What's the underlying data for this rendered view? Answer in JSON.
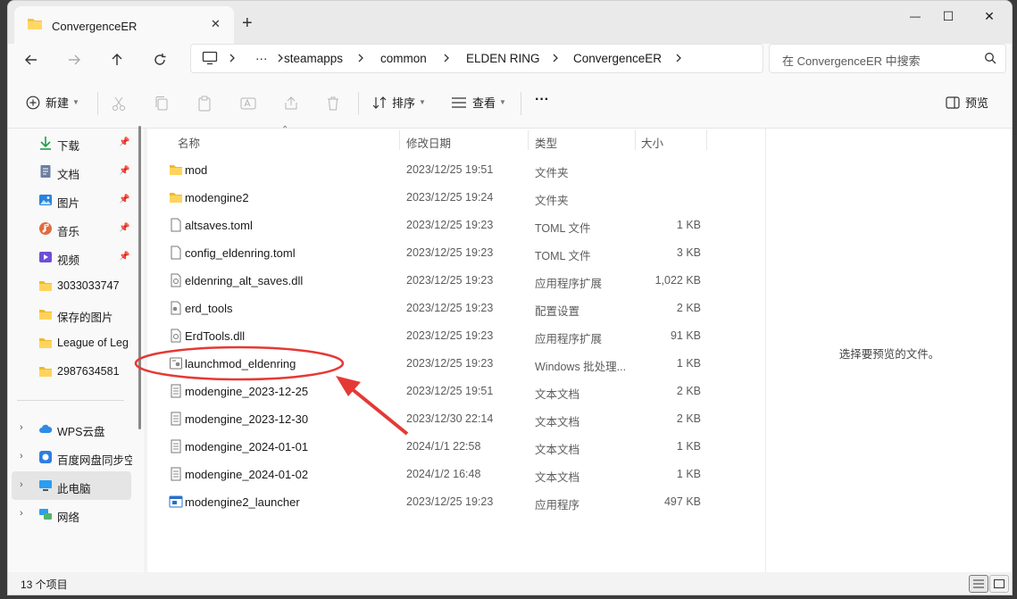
{
  "window": {
    "tab_title": "ConvergenceER",
    "new_tab_glyph": "+",
    "close_glyph": "✕",
    "minimize_glyph": "—",
    "maximize_glyph": "☐",
    "close_window_glyph": "✕"
  },
  "address": {
    "more": "···",
    "crumbs": [
      "steamapps",
      "common",
      "ELDEN RING",
      "ConvergenceER"
    ],
    "search_placeholder": "在 ConvergenceER 中搜索"
  },
  "toolbar": {
    "new_label": "新建",
    "sort_label": "排序",
    "view_label": "查看",
    "more_label": "···",
    "preview_label": "预览"
  },
  "sidebar": {
    "items": [
      {
        "label": "下载",
        "icon": "download-icon",
        "pinned": true
      },
      {
        "label": "文档",
        "icon": "document-icon",
        "pinned": true
      },
      {
        "label": "图片",
        "icon": "picture-icon",
        "pinned": true
      },
      {
        "label": "音乐",
        "icon": "music-icon",
        "pinned": true
      },
      {
        "label": "视频",
        "icon": "video-icon",
        "pinned": true
      },
      {
        "label": "3033033747",
        "icon": "folder-icon"
      },
      {
        "label": "保存的图片",
        "icon": "folder-icon"
      },
      {
        "label": "League of Legends",
        "icon": "folder-icon"
      },
      {
        "label": "2987634581",
        "icon": "folder-icon"
      }
    ],
    "locations": [
      {
        "label": "WPS云盘",
        "icon": "cloud-icon"
      },
      {
        "label": "百度网盘同步空间",
        "icon": "baidu-icon"
      },
      {
        "label": "此电脑",
        "icon": "computer-icon",
        "selected": true
      },
      {
        "label": "网络",
        "icon": "network-icon"
      }
    ]
  },
  "columns": {
    "name": "名称",
    "date": "修改日期",
    "type": "类型",
    "size": "大小"
  },
  "files": [
    {
      "name": "mod",
      "date": "2023/12/25 19:51",
      "type": "文件夹",
      "size": "",
      "icon": "folder-icon"
    },
    {
      "name": "modengine2",
      "date": "2023/12/25 19:24",
      "type": "文件夹",
      "size": "",
      "icon": "folder-icon"
    },
    {
      "name": "altsaves.toml",
      "date": "2023/12/25 19:23",
      "type": "TOML 文件",
      "size": "1 KB",
      "icon": "file-icon"
    },
    {
      "name": "config_eldenring.toml",
      "date": "2023/12/25 19:23",
      "type": "TOML 文件",
      "size": "3 KB",
      "icon": "file-icon"
    },
    {
      "name": "eldenring_alt_saves.dll",
      "date": "2023/12/25 19:23",
      "type": "应用程序扩展",
      "size": "1,022 KB",
      "icon": "dll-icon"
    },
    {
      "name": "erd_tools",
      "date": "2023/12/25 19:23",
      "type": "配置设置",
      "size": "2 KB",
      "icon": "config-icon"
    },
    {
      "name": "ErdTools.dll",
      "date": "2023/12/25 19:23",
      "type": "应用程序扩展",
      "size": "91 KB",
      "icon": "dll-icon"
    },
    {
      "name": "launchmod_eldenring",
      "date": "2023/12/25 19:23",
      "type": "Windows 批处理...",
      "size": "1 KB",
      "icon": "batch-icon"
    },
    {
      "name": "modengine_2023-12-25",
      "date": "2023/12/25 19:51",
      "type": "文本文档",
      "size": "2 KB",
      "icon": "text-icon"
    },
    {
      "name": "modengine_2023-12-30",
      "date": "2023/12/30 22:14",
      "type": "文本文档",
      "size": "2 KB",
      "icon": "text-icon"
    },
    {
      "name": "modengine_2024-01-01",
      "date": "2024/1/1 22:58",
      "type": "文本文档",
      "size": "1 KB",
      "icon": "text-icon"
    },
    {
      "name": "modengine_2024-01-02",
      "date": "2024/1/2 16:48",
      "type": "文本文档",
      "size": "1 KB",
      "icon": "text-icon"
    },
    {
      "name": "modengine2_launcher",
      "date": "2023/12/25 19:23",
      "type": "应用程序",
      "size": "497 KB",
      "icon": "exe-icon"
    }
  ],
  "preview": {
    "message": "选择要预览的文件。"
  },
  "status": {
    "count": "13 个项目"
  },
  "colors": {
    "folder": "#f5c342",
    "accent": "#0067c0",
    "annotation": "#e53935"
  }
}
